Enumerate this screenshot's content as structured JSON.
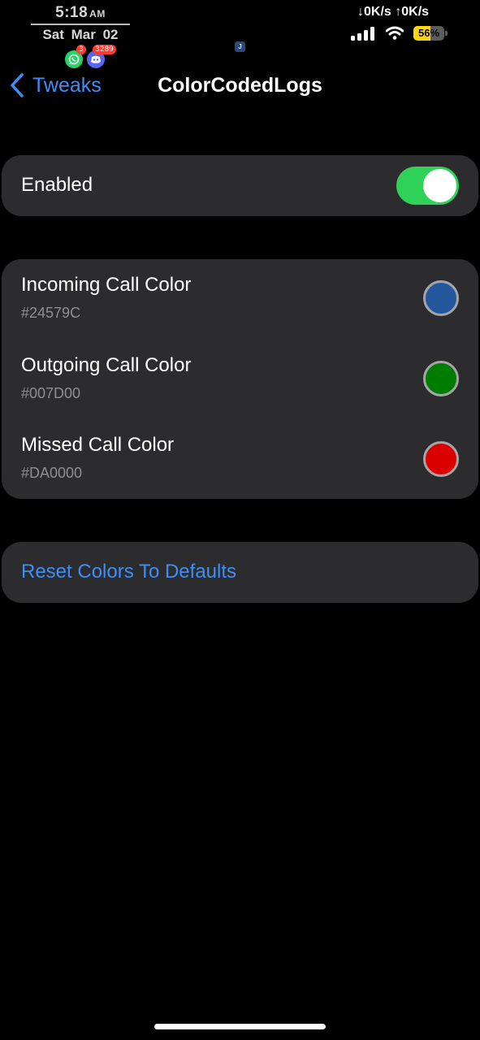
{
  "status_bar": {
    "time": "5:18",
    "ampm": "AM",
    "date": "Sat  Mar 02",
    "network_speed": "↓0K/s ↑0K/s",
    "battery_percent": "56%",
    "battery_level": 0.56,
    "notifications": [
      {
        "app": "whatsapp-icon",
        "badge": "3"
      },
      {
        "app": "discord-icon",
        "badge": "3289"
      }
    ],
    "center_indicator": "J"
  },
  "nav": {
    "back_label": "Tweaks",
    "title": "ColorCodedLogs"
  },
  "enabled_row": {
    "label": "Enabled",
    "value": true
  },
  "color_rows": [
    {
      "label": "Incoming Call Color",
      "hex": "#24579C",
      "color": "#24579C"
    },
    {
      "label": "Outgoing Call Color",
      "hex": "#007D00",
      "color": "#007D00"
    },
    {
      "label": "Missed Call Color",
      "hex": "#DA0000",
      "color": "#DA0000"
    }
  ],
  "reset": {
    "label": "Reset Colors To Defaults"
  },
  "colors": {
    "accent": "#3E8EF7",
    "toggle_on": "#30D158",
    "group_bg": "#2C2C2E",
    "secondary_text": "#8E8E93"
  }
}
